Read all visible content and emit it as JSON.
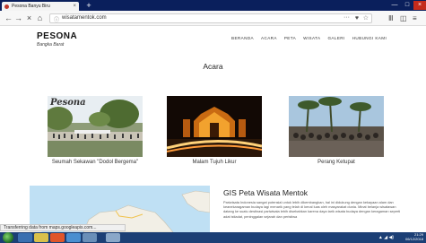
{
  "browser": {
    "tab_title": "Pesona Banyu Biru",
    "tab_close": "×",
    "new_tab": "+",
    "url": "wisatamentok.com",
    "back": "←",
    "forward": "→",
    "reload": "×",
    "home": "⌂",
    "page_actions": "···",
    "pocket": "♥",
    "star": "☆",
    "library": "Ⅲ",
    "sidebar": "◫",
    "menu": "≡",
    "minimize": "—",
    "maximize": "□",
    "close": "×"
  },
  "site": {
    "brand": "PESONA",
    "tagline": "Bangka Barat",
    "menu": [
      "BERANDA",
      "ACARA",
      "PETA",
      "WISATA",
      "GALERI",
      "HUBUNGI KAMI"
    ]
  },
  "acara": {
    "title": "Acara",
    "cards": [
      {
        "label": "Seumah Sekawan \"Dodol Bergema\"",
        "overlay": "Pesona"
      },
      {
        "label": "Malam Tujuh Likur"
      },
      {
        "label": "Perang Ketupat"
      }
    ]
  },
  "gis": {
    "title": "GIS Peta Wisata Mentok",
    "text": "Pariwisata Indonesia sangat potensial untuk lebih dikembangkan, hal ini didukung dengan kekayaan alam dan keanekaragaman budaya lagi menarik yang telah di kenal luas oleh masyarakat dunia. Minat belanja wisatawan datang ke suatu destinasi pariwisata lebih disebabkan karena daya tarik wisata budaya dengan keragaman seperti adat istiadat, peninggalan sejarah dan peristiwa"
  },
  "status": {
    "text": "Transferring data from maps.googleapis.com..."
  },
  "taskbar": {
    "time": "21:29",
    "date": "06/12/2018"
  },
  "colors": {
    "tabstrip": "#0a1f5c",
    "taskbar": "#1c3f75",
    "map_water": "#bfe0f4"
  }
}
